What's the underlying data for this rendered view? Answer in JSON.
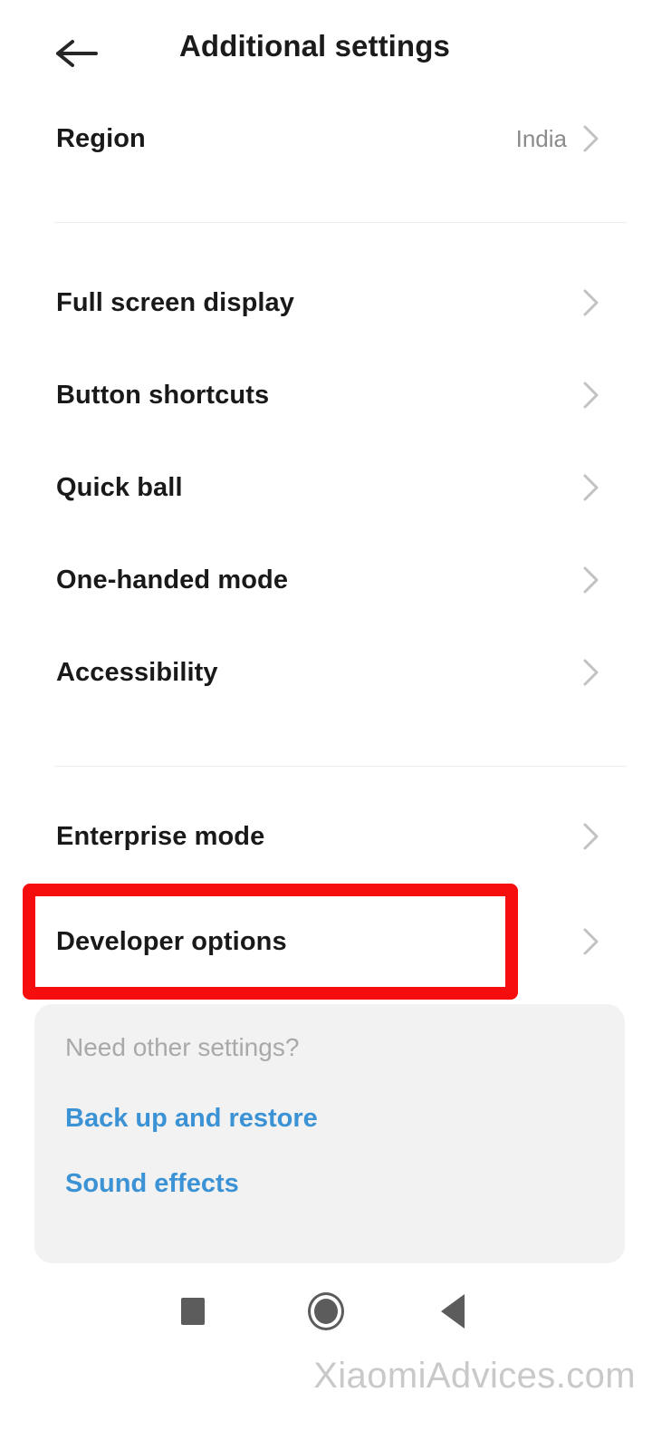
{
  "header": {
    "title": "Additional settings",
    "back_icon": "arrow-left-icon"
  },
  "sections": [
    {
      "id": "region-section",
      "rows": [
        {
          "label": "Region",
          "value": "India",
          "chevron": "chevron-right-icon"
        }
      ]
    },
    {
      "id": "display-section",
      "rows": [
        {
          "label": "Full screen display",
          "value": "",
          "chevron": "chevron-right-icon"
        },
        {
          "label": "Button shortcuts",
          "value": "",
          "chevron": "chevron-right-icon"
        },
        {
          "label": "Quick ball",
          "value": "",
          "chevron": "chevron-right-icon"
        },
        {
          "label": "One-handed mode",
          "value": "",
          "chevron": "chevron-right-icon"
        },
        {
          "label": "Accessibility",
          "value": "",
          "chevron": "chevron-right-icon"
        }
      ]
    },
    {
      "id": "advanced-section",
      "rows": [
        {
          "label": "Enterprise mode",
          "value": "",
          "chevron": "chevron-right-icon"
        },
        {
          "label": "Developer options",
          "value": "",
          "chevron": "chevron-right-icon"
        }
      ]
    }
  ],
  "annotation": {
    "target": "Developer options",
    "color": "#f60d0d"
  },
  "footer_card": {
    "title": "Need other settings?",
    "links": [
      {
        "label": "Back up and restore"
      },
      {
        "label": "Sound effects"
      }
    ],
    "link_color": "#3b92d4",
    "background": "#f2f2f2"
  },
  "navbar": {
    "buttons": [
      {
        "name": "recents",
        "icon": "square-icon"
      },
      {
        "name": "home",
        "icon": "circle-icon"
      },
      {
        "name": "back",
        "icon": "triangle-left-icon"
      }
    ]
  },
  "watermark": {
    "text": "XiaomiAdvices.com"
  }
}
